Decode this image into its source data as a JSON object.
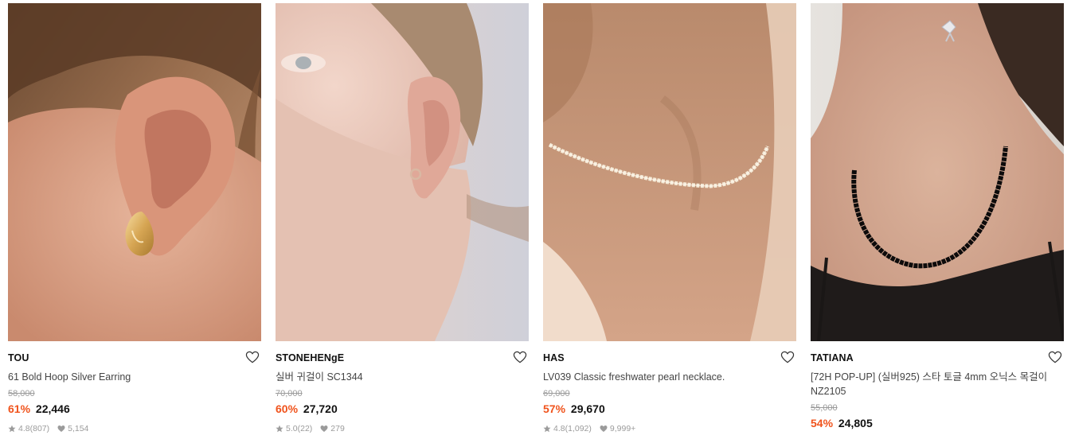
{
  "products": [
    {
      "brand": "TOU",
      "name": "61 Bold Hoop Silver Earring",
      "original_price": "58,000",
      "discount": "61%",
      "price": "22,446",
      "rating": "4.8",
      "reviews": "(807)",
      "likes": "5,154",
      "image": "ear-with-gold-hoop-earring"
    },
    {
      "brand": "STONEHENgE",
      "name": "실버 귀걸이 SC1344",
      "original_price": "70,000",
      "discount": "60%",
      "price": "27,720",
      "rating": "5.0",
      "reviews": "(22)",
      "likes": "279",
      "image": "ear-with-small-hoop-earring"
    },
    {
      "brand": "HAS",
      "name": "LV039 Classic freshwater pearl necklace.",
      "original_price": "69,000",
      "discount": "57%",
      "price": "29,670",
      "rating": "4.8",
      "reviews": "(1,092)",
      "likes": "9,999+",
      "image": "neck-with-pearl-necklace"
    },
    {
      "brand": "TATIANA",
      "name": "[72H POP-UP] (실버925) 스타 토글 4mm 오닉스 목걸이 NZ2105",
      "original_price": "55,000",
      "discount": "54%",
      "price": "24,805",
      "rating": "",
      "reviews": "",
      "likes": "",
      "image": "neck-with-black-onyx-necklace"
    }
  ],
  "colors": {
    "discount": "#f0531c",
    "muted": "#9b9b9b",
    "text": "#111111"
  },
  "icons": {
    "wishlist": "heart-outline-icon",
    "rating": "star-icon",
    "likes": "heart-filled-icon"
  }
}
